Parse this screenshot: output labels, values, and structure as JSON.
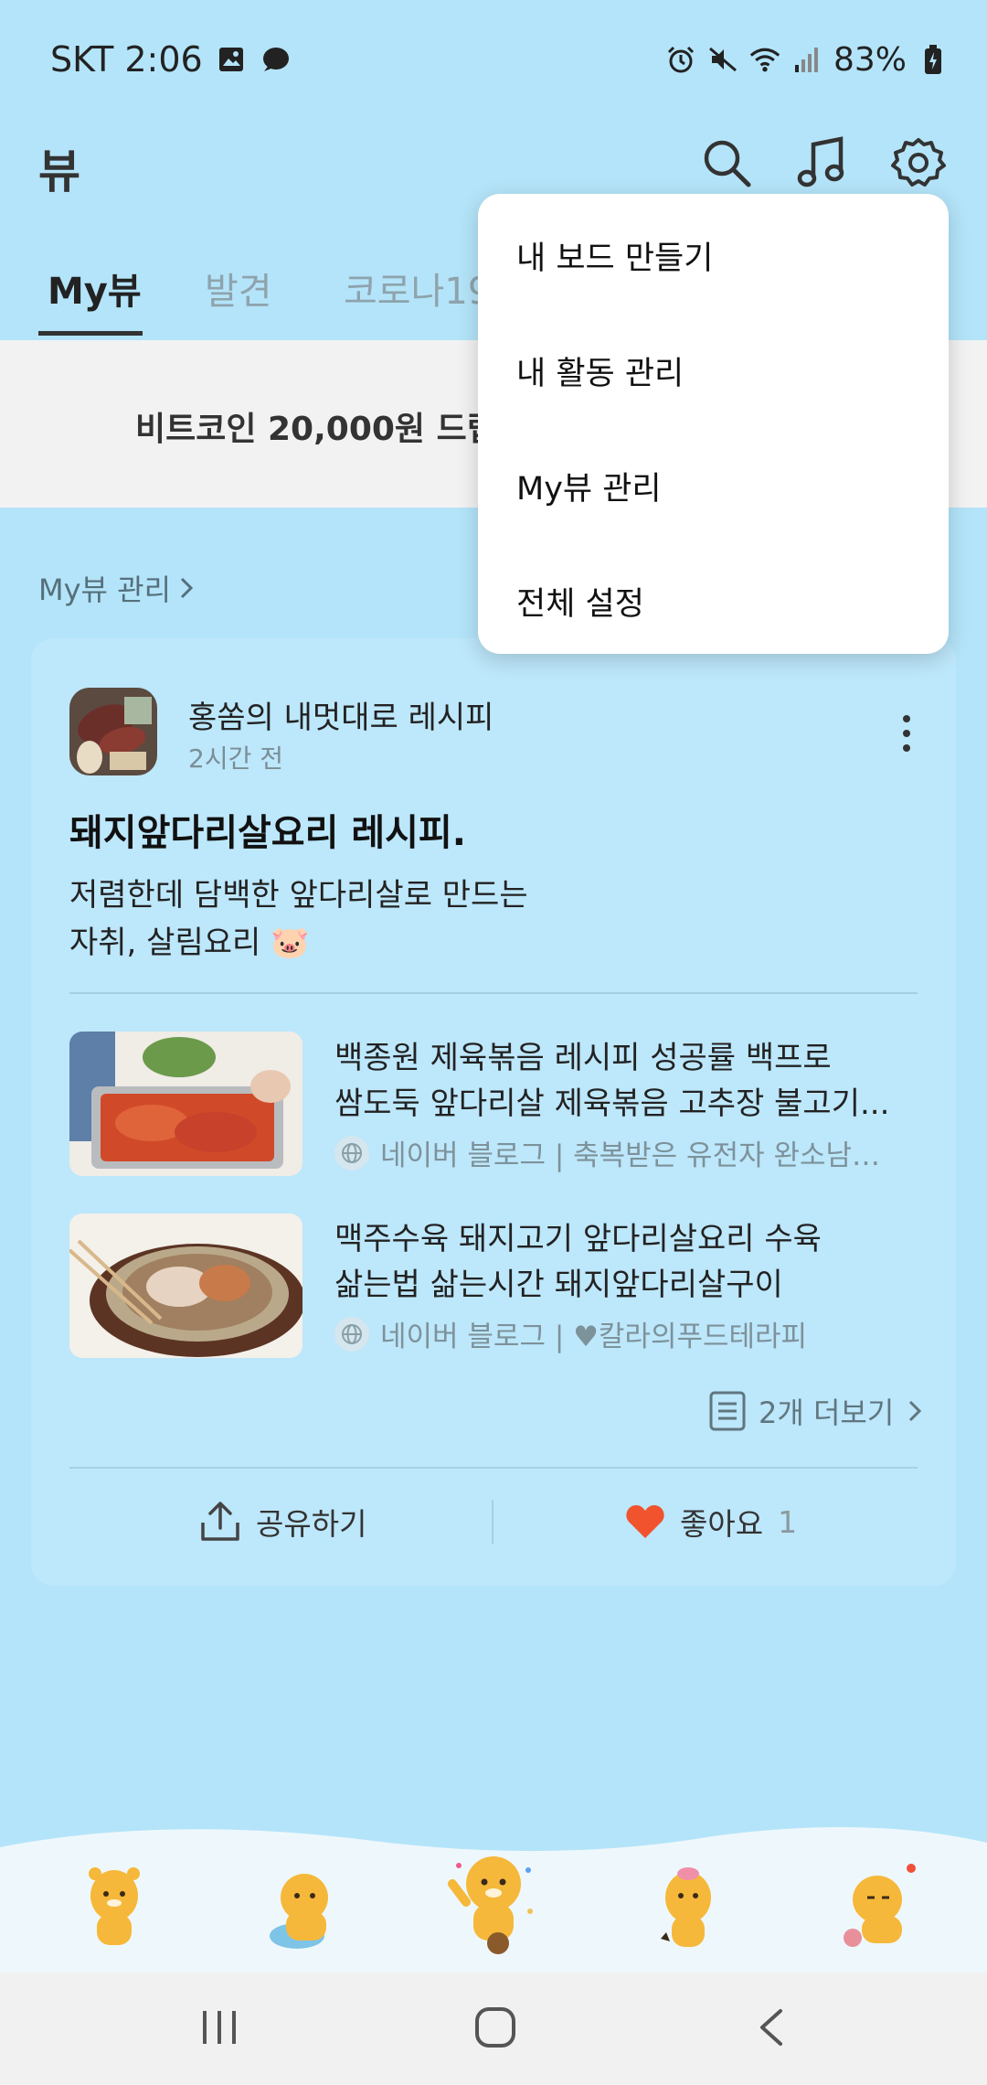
{
  "status_bar": {
    "carrier_time": "SKT 2:06",
    "battery": "83%"
  },
  "app": {
    "title": "뷰"
  },
  "tabs": [
    {
      "label": "My뷰",
      "active": true
    },
    {
      "label": "발견",
      "active": false
    },
    {
      "label": "코로나19",
      "active": false
    }
  ],
  "banner": {
    "text": "비트코인 20,000원 드립"
  },
  "manage_link": {
    "label": "My뷰 관리"
  },
  "card": {
    "source": "홍쏨의 내멋대로 레시피",
    "time": "2시간 전",
    "title": "돼지앞다리살요리 레시피.",
    "desc_line1": "저렴한데 담백한 앞다리살로 만드는",
    "desc_line2": "자취, 살림요리 🐷",
    "related": [
      {
        "title_line1": "백종원 제육볶음 레시피 성공률 백프로",
        "title_line2": "쌈도둑 앞다리살 제육볶음 고추장 불고기...",
        "meta": "네이버 블로그 | 축복받은 유전자 완소남매..."
      },
      {
        "title_line1": "맥주수육 돼지고기 앞다리살요리 수육",
        "title_line2": "삶는법 삶는시간 돼지앞다리살구이",
        "meta": "네이버 블로그 | ♥칼라의푸드테라피"
      }
    ],
    "more_label": "2개 더보기",
    "share_label": "공유하기",
    "like_label": "좋아요",
    "like_count": "1"
  },
  "menu": {
    "items": [
      "내 보드 만들기",
      "내 활동 관리",
      "My뷰 관리",
      "전체 설정"
    ]
  },
  "colors": {
    "background": "#b4e4f9",
    "card": "#bde7fb",
    "heart": "#f0532d",
    "character": "#f6b83a"
  },
  "icons": [
    "search-icon",
    "music-icon",
    "settings-icon",
    "share-icon",
    "heart-icon",
    "list-icon",
    "globe-icon",
    "kebab-icon"
  ]
}
